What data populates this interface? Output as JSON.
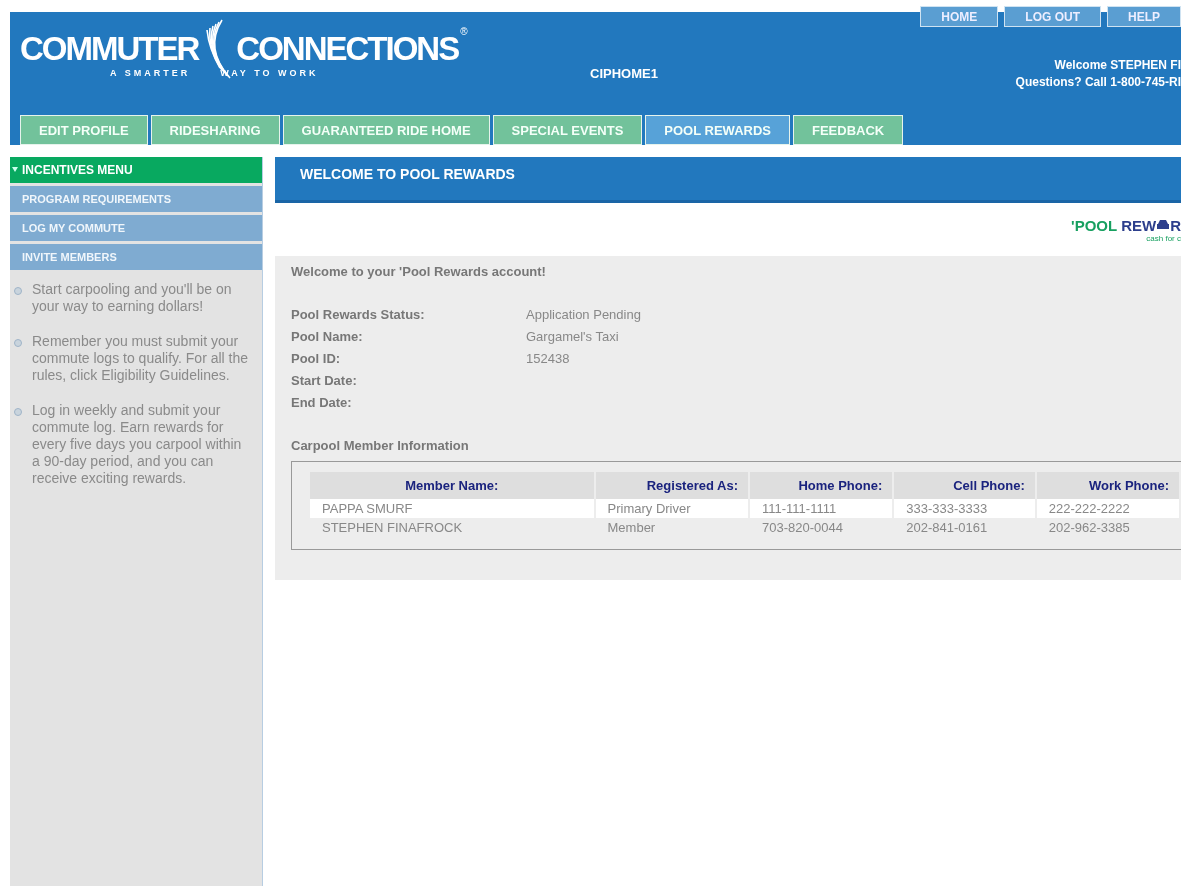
{
  "header": {
    "logo": {
      "word_1": "COMMUTER",
      "word_2": "CONNECTIONS",
      "mark": "®",
      "tagline_1": "A SMARTER",
      "tagline_2": "WAY TO WORK"
    },
    "page_code": "CIPHOME1",
    "top_links": [
      "HOME",
      "LOG OUT",
      "HELP"
    ],
    "welcome": "Welcome STEPHEN FI",
    "questions": "Questions? Call 1-800-745-RI"
  },
  "tabs": [
    {
      "label": "EDIT PROFILE",
      "selected": false
    },
    {
      "label": "RIDESHARING",
      "selected": false
    },
    {
      "label": "GUARANTEED RIDE HOME",
      "selected": false
    },
    {
      "label": "SPECIAL EVENTS",
      "selected": false
    },
    {
      "label": "POOL REWARDS",
      "selected": true
    },
    {
      "label": "FEEDBACK",
      "selected": false
    }
  ],
  "sidebar": {
    "menu_title": "INCENTIVES MENU",
    "items": [
      "PROGRAM REQUIREMENTS",
      "LOG MY COMMUTE",
      "INVITE MEMBERS"
    ],
    "tips": [
      "Start carpooling and you'll be on your way to earning dollars!",
      "Remember you must submit your commute logs to qualify. For all the rules, click Eligibility Guidelines.",
      "Log in weekly and submit your commute log. Earn rewards for every five days you carpool within a 90-day period, and you can receive exciting rewards."
    ]
  },
  "content": {
    "title": "WELCOME TO POOL REWARDS",
    "brand": {
      "text_1": "'POOL",
      "text_2": "REW",
      "text_3": "R",
      "tagline": "cash for c"
    },
    "intro": "Welcome to your 'Pool Rewards account!",
    "fields": [
      {
        "label": "Pool Rewards Status:",
        "value": "Application Pending"
      },
      {
        "label": "Pool Name:",
        "value": "Gargamel's Taxi"
      },
      {
        "label": "Pool ID:",
        "value": "152438"
      },
      {
        "label": "Start Date:"
      },
      {
        "label": "End Date:"
      }
    ],
    "members_title": "Carpool Member Information",
    "table": {
      "columns": [
        "Member Name:",
        "Registered As:",
        "Home Phone:",
        "Cell Phone:",
        "Work Phone:"
      ],
      "rows": [
        [
          "PAPPA SMURF",
          "Primary Driver",
          "111-111-1111",
          "333-333-3333",
          "222-222-2222"
        ],
        [
          "STEPHEN FINAFROCK",
          "Member",
          "703-820-0044",
          "202-841-0161",
          "202-962-3385"
        ]
      ]
    }
  }
}
